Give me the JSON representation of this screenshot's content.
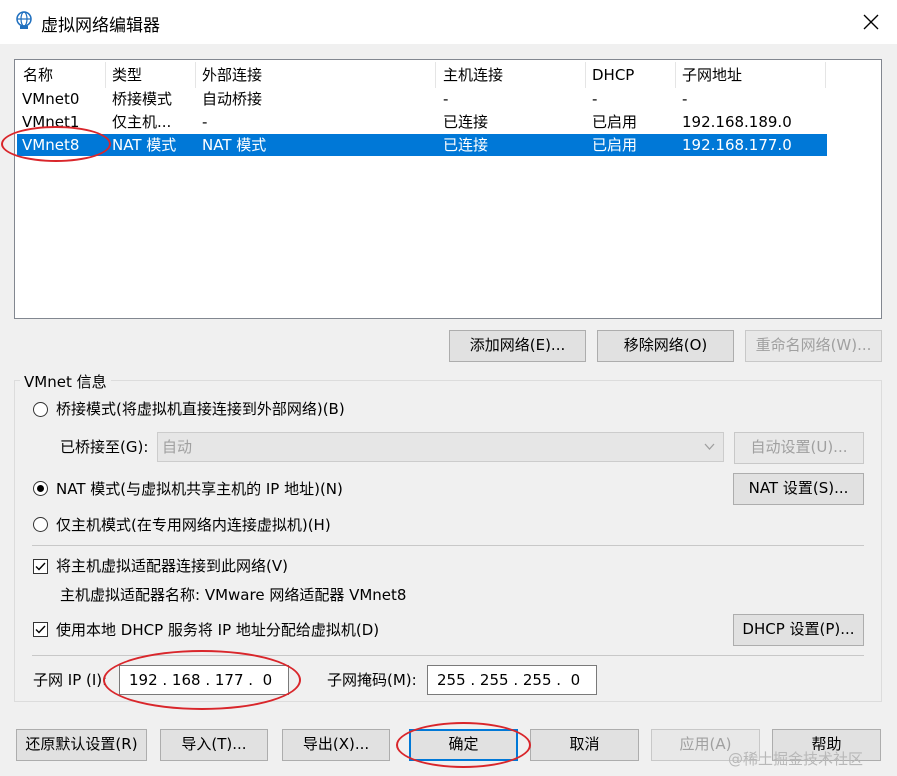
{
  "window": {
    "title": "虚拟网络编辑器"
  },
  "table": {
    "headers": [
      "名称",
      "类型",
      "外部连接",
      "主机连接",
      "DHCP",
      "子网地址"
    ],
    "rows": [
      [
        "VMnet0",
        "桥接模式",
        "自动桥接",
        "-",
        "-",
        "-"
      ],
      [
        "VMnet1",
        "仅主机...",
        "-",
        "已连接",
        "已启用",
        "192.168.189.0"
      ],
      [
        "VMnet8",
        "NAT 模式",
        "NAT 模式",
        "已连接",
        "已启用",
        "192.168.177.0"
      ]
    ],
    "selected_index": 2
  },
  "list_buttons": {
    "add": "添加网络(E)...",
    "remove": "移除网络(O)",
    "rename": "重命名网络(W)..."
  },
  "info": {
    "group_title": "VMnet 信息",
    "bridged_radio": "桥接模式(将虚拟机直接连接到外部网络)(B)",
    "bridged_to_label": "已桥接至(G):",
    "bridged_to_value": "自动",
    "auto_settings_button": "自动设置(U)...",
    "nat_radio": "NAT 模式(与虚拟机共享主机的 IP 地址)(N)",
    "nat_settings_button": "NAT 设置(S)...",
    "hostonly_radio": "仅主机模式(在专用网络内连接虚拟机)(H)",
    "connect_adapter_check": "将主机虚拟适配器连接到此网络(V)",
    "adapter_name_text": "主机虚拟适配器名称: VMware 网络适配器 VMnet8",
    "dhcp_check": "使用本地 DHCP 服务将 IP 地址分配给虚拟机(D)",
    "dhcp_settings_button": "DHCP 设置(P)...",
    "subnet_ip_label": "子网 IP (I):",
    "subnet_ip_value": "192 . 168 . 177 .  0",
    "subnet_mask_label": "子网掩码(M):",
    "subnet_mask_value": "255 . 255 . 255 .  0"
  },
  "footer_buttons": {
    "restore": "还原默认设置(R)",
    "import": "导入(T)...",
    "export": "导出(X)...",
    "ok": "确定",
    "cancel": "取消",
    "apply": "应用(A)",
    "help": "帮助"
  },
  "watermark": "@稀土掘金技术社区",
  "colors": {
    "selection": "#0078d7",
    "annotation": "#d9262b"
  },
  "icons": {
    "title": "network-globe-icon",
    "close": "close-icon",
    "check": "checkmark-icon",
    "combo": "chevron-down-icon"
  }
}
